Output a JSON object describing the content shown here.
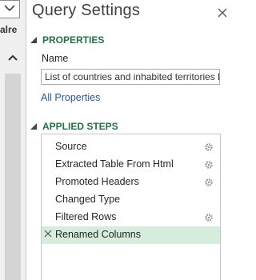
{
  "left_strip": {
    "partial_text": "alre",
    "dropdown_icon": "chevron-down-icon",
    "scroll_icon": "chevron-up-icon"
  },
  "pane": {
    "title": "Query Settings",
    "close_icon": "close-icon"
  },
  "properties": {
    "heading": "PROPERTIES",
    "name_label": "Name",
    "name_value": "List of countries and inhabited territories b",
    "all_properties_link": "All Properties"
  },
  "applied_steps": {
    "heading": "APPLIED STEPS",
    "steps": [
      {
        "label": "Source",
        "has_gear": true,
        "selected": false
      },
      {
        "label": "Extracted Table From Html",
        "has_gear": true,
        "selected": false
      },
      {
        "label": "Promoted Headers",
        "has_gear": true,
        "selected": false
      },
      {
        "label": "Changed Type",
        "has_gear": false,
        "selected": false
      },
      {
        "label": "Filtered Rows",
        "has_gear": true,
        "selected": false
      },
      {
        "label": "Renamed Columns",
        "has_gear": false,
        "selected": true
      }
    ]
  },
  "colors": {
    "accent_green": "#217346",
    "link_blue": "#2b579a",
    "selected_row": "#d6ecdc"
  }
}
